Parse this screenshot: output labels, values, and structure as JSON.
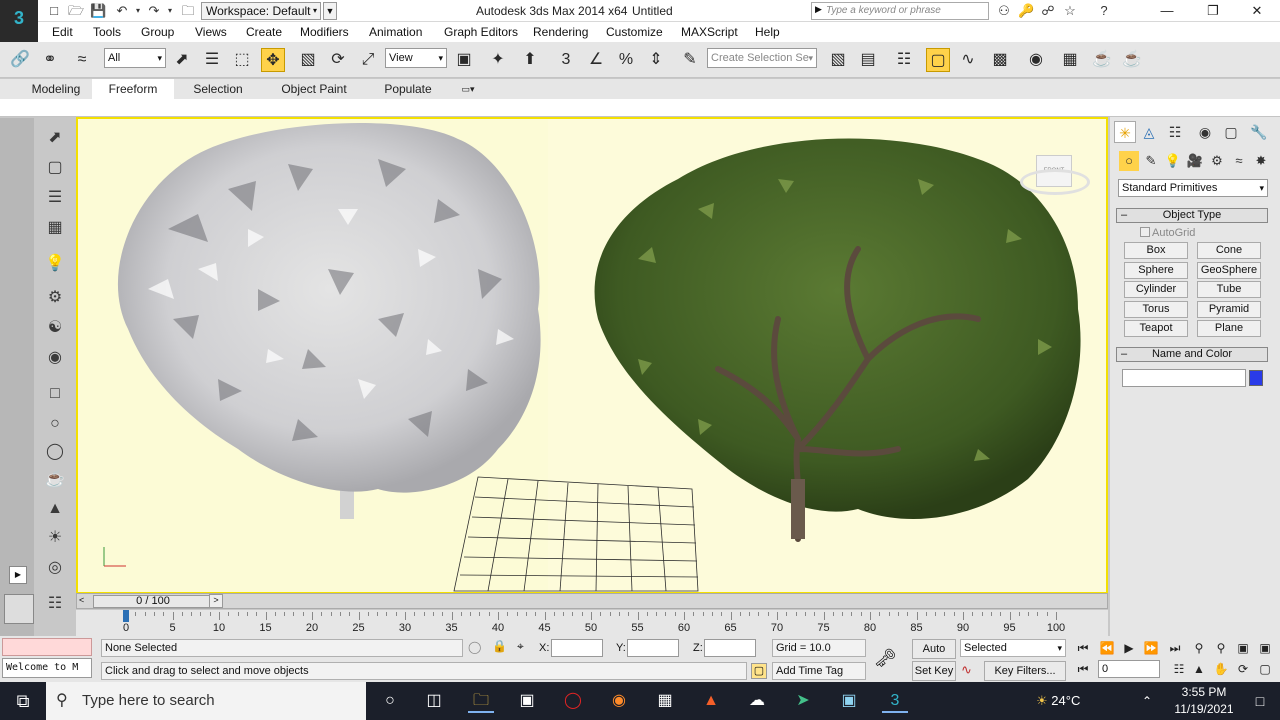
{
  "titlebar": {
    "logo": "3",
    "workspace": "Workspace: Default",
    "app_title": "Autodesk 3ds Max  2014 x64",
    "doc_title": "Untitled",
    "search_placeholder": "Type a keyword or phrase",
    "min": "—",
    "max": "❐",
    "close": "✕"
  },
  "menu": [
    "Edit",
    "Tools",
    "Group",
    "Views",
    "Create",
    "Modifiers",
    "Animation",
    "Graph Editors",
    "Rendering",
    "Customize",
    "MAXScript",
    "Help"
  ],
  "toolbar": {
    "selection_filter": "All",
    "ref_coord": "View",
    "named_selection": "Create Selection Se"
  },
  "ribbon": {
    "tabs": [
      "Modeling",
      "Freeform",
      "Selection",
      "Object Paint",
      "Populate"
    ],
    "active_tab": "Freeform"
  },
  "command_panel": {
    "category": "Standard Primitives",
    "object_type_title": "Object Type",
    "autogrid": "AutoGrid",
    "primitives": [
      "Box",
      "Cone",
      "Sphere",
      "GeoSphere",
      "Cylinder",
      "Tube",
      "Torus",
      "Pyramid",
      "Teapot",
      "Plane"
    ],
    "name_color_title": "Name and Color",
    "name_value": "",
    "object_color": "#2a3be8"
  },
  "viewport": {
    "border_color": "#f4e000",
    "background": "#fcfbd6",
    "viewcube_label": "FRONT"
  },
  "timeline": {
    "frame_display": "0 / 100",
    "ticks": [
      0,
      5,
      10,
      15,
      20,
      25,
      30,
      35,
      40,
      45,
      50,
      55,
      60,
      65,
      70,
      75,
      80,
      85,
      90,
      95,
      100
    ]
  },
  "status": {
    "maxscript_listener": "Welcome to M",
    "selection": "None Selected",
    "prompt": "Click and drag to select and move objects",
    "x_label": "X:",
    "y_label": "Y:",
    "z_label": "Z:",
    "grid": "Grid = 10.0",
    "add_time_tag": "Add Time Tag",
    "auto_key": "Auto Key",
    "set_key": "Set Key",
    "key_mode": "Selected",
    "key_filters": "Key Filters...",
    "current_frame": "0"
  },
  "taskbar": {
    "search_placeholder": "Type here to search",
    "temperature": "24°C",
    "time": "3:55 PM",
    "date": "11/19/2021"
  }
}
